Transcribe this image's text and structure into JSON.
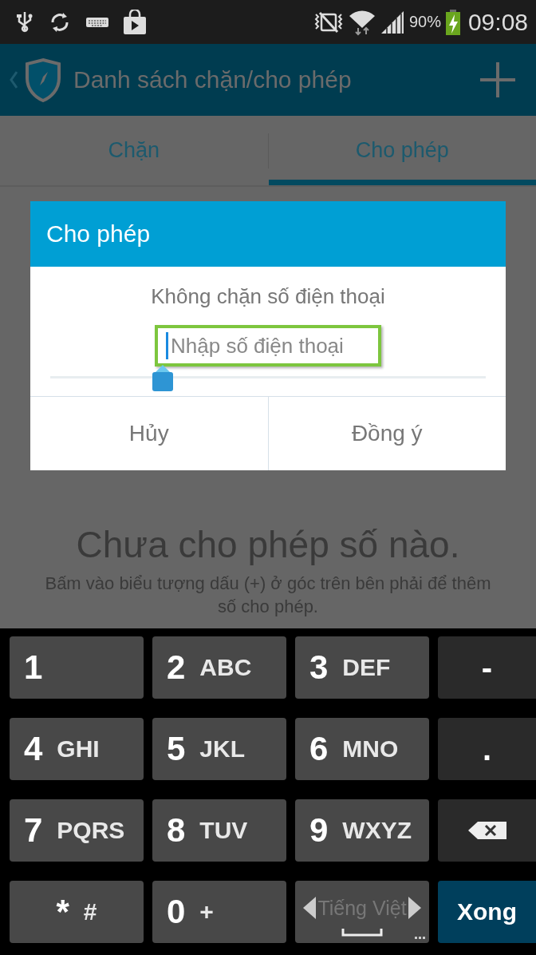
{
  "status_bar": {
    "battery": "90%",
    "time": "09:08"
  },
  "app_bar": {
    "title": "Danh sách chặn/cho phép"
  },
  "tabs": [
    {
      "label": "Chặn",
      "selected": false
    },
    {
      "label": "Cho phép",
      "selected": true
    }
  ],
  "empty_state": {
    "title": "Chưa cho phép số nào.",
    "hint": "Bấm vào biểu tượng dấu (+) ở góc trên bên phải để thêm số cho phép."
  },
  "dialog": {
    "title": "Cho phép",
    "message": "Không chặn số điện thoại",
    "input": {
      "placeholder": "Nhập số điện thoại",
      "highlighted": true
    },
    "buttons": [
      "Hủy",
      "Đồng ý"
    ]
  },
  "keyboard": [
    {
      "kind": "digit",
      "main": "1"
    },
    {
      "kind": "digit",
      "main": "2",
      "sub": "ABC"
    },
    {
      "kind": "digit",
      "main": "3",
      "sub": "DEF"
    },
    {
      "kind": "symbol",
      "main": "-"
    },
    {
      "kind": "digit",
      "main": "4",
      "sub": "GHI"
    },
    {
      "kind": "digit",
      "main": "5",
      "sub": "JKL"
    },
    {
      "kind": "digit",
      "main": "6",
      "sub": "MNO"
    },
    {
      "kind": "symbol",
      "main": "."
    },
    {
      "kind": "digit",
      "main": "7",
      "sub": "PQRS"
    },
    {
      "kind": "digit",
      "main": "8",
      "sub": "TUV"
    },
    {
      "kind": "digit",
      "main": "9",
      "sub": "WXYZ"
    },
    {
      "kind": "backspace"
    },
    {
      "kind": "digit",
      "main": "*",
      "sub": "#",
      "center": true
    },
    {
      "kind": "digit",
      "main": "0",
      "sub": "+"
    },
    {
      "kind": "lang",
      "main": "Tiếng Việt"
    },
    {
      "kind": "done",
      "main": "Xong"
    }
  ]
}
